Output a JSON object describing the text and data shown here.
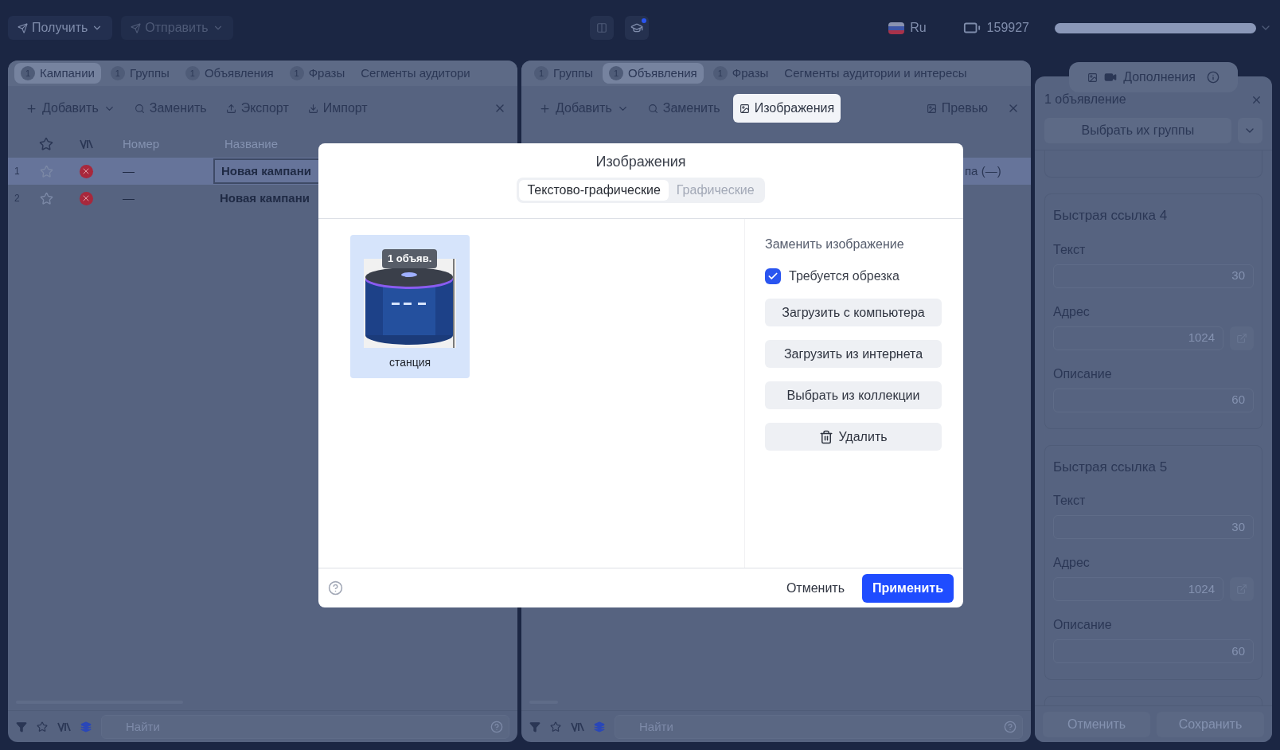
{
  "top_bar": {
    "receive": "Получить",
    "send": "Отправить",
    "language": "Ru",
    "balance": "159927"
  },
  "left_panel": {
    "tabs": [
      {
        "count": "1",
        "label": "Кампании",
        "selected": true
      },
      {
        "count": "1",
        "label": "Группы",
        "selected": false
      },
      {
        "count": "1",
        "label": "Объявления",
        "selected": false
      },
      {
        "count": "1",
        "label": "Фразы",
        "selected": false
      },
      {
        "label": "Сегменты аудитори",
        "selected": false
      }
    ],
    "actions": [
      {
        "label": "Добавить",
        "kind": "add",
        "selected": false
      },
      {
        "label": "Заменить",
        "kind": "replace",
        "selected": false
      },
      {
        "label": "Экспорт",
        "kind": "export",
        "selected": false
      },
      {
        "label": "Импорт",
        "kind": "import",
        "selected": false
      }
    ],
    "columns": [
      "Номер",
      "Название"
    ],
    "rows": [
      {
        "index": "1",
        "number": "—",
        "name": "Новая кампани",
        "selected": true,
        "focused": true
      },
      {
        "index": "2",
        "number": "—",
        "name": "Новая кампани",
        "selected": false,
        "focused": false
      }
    ],
    "search": {
      "placeholder": "Найти"
    }
  },
  "middle_panel": {
    "tabs": [
      {
        "count": "1",
        "label": "Группы",
        "selected": false
      },
      {
        "count": "1",
        "label": "Объявления",
        "selected": true
      },
      {
        "count": "1",
        "label": "Фразы",
        "selected": false
      },
      {
        "label": "Сегменты аудитории и интересы",
        "selected": false
      }
    ],
    "actions": [
      {
        "label": "Добавить",
        "kind": "add",
        "selected": false
      },
      {
        "label": "Заменить",
        "kind": "replace",
        "selected": false
      },
      {
        "label": "Изображения",
        "kind": "images",
        "selected": true
      },
      {
        "label": "Превью",
        "kind": "preview",
        "selected": false
      }
    ],
    "rows": [
      {
        "group": "па (—)",
        "selected": true
      }
    ],
    "search": {
      "placeholder": "Найти"
    }
  },
  "right_panel": {
    "tab_label": "Дополнения",
    "header": "1 объявление",
    "select_label": "Выбрать их группы",
    "cards": [
      {
        "title": "Быстрая ссылка 4",
        "fields": [
          {
            "label": "Текст",
            "counter": "30",
            "kind": "text"
          },
          {
            "label": "Адрес",
            "counter": "1024",
            "kind": "url"
          },
          {
            "label": "Описание",
            "counter": "60",
            "kind": "text"
          }
        ]
      },
      {
        "title": "Быстрая ссылка 5",
        "fields": [
          {
            "label": "Текст",
            "counter": "30",
            "kind": "text"
          },
          {
            "label": "Адрес",
            "counter": "1024",
            "kind": "url"
          },
          {
            "label": "Описание",
            "counter": "60",
            "kind": "text"
          }
        ]
      }
    ],
    "cancel": "Отменить",
    "save": "Сохранить"
  },
  "modal": {
    "title": "Изображения",
    "tabs": [
      {
        "label": "Текстово-графические",
        "selected": true
      },
      {
        "label": "Графические",
        "selected": false
      }
    ],
    "images": [
      {
        "badge": "1 объяв.",
        "caption": "станция",
        "selected": true
      }
    ],
    "side_title": "Заменить изображение",
    "checkbox": {
      "label": "Требуется обрезка",
      "checked": true
    },
    "buttons": [
      {
        "label": "Загрузить с компьютера",
        "kind": "plain"
      },
      {
        "label": "Загрузить из интернета",
        "kind": "plain"
      },
      {
        "label": "Выбрать из коллекции",
        "kind": "plain"
      },
      {
        "label": "Удалить",
        "kind": "delete"
      }
    ],
    "cancel": "Отменить",
    "apply": "Применить"
  }
}
